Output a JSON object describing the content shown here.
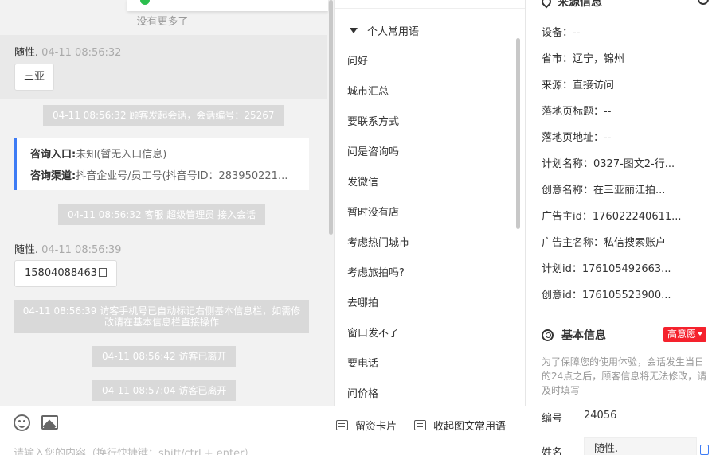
{
  "chat": {
    "no_more": "没有更多了",
    "msg1": {
      "sender": "随性.",
      "time": "04-11 08:56:32",
      "text": "三亚"
    },
    "sys1": "04-11 08:56:32 顾客发起会话，会话编号：25267",
    "consult": {
      "entry_label": "咨询入口:",
      "entry_value": "未知(暂无入口信息)",
      "channel_label": "咨询渠道:",
      "channel_value": "抖音企业号/员工号(抖音号ID：283950221..."
    },
    "sys2": "04-11 08:56:32 客服 超级管理员 接入会话",
    "msg2": {
      "sender": "随性.",
      "time": "04-11 08:56:39",
      "text": "15804088463"
    },
    "sys3": "04-11 08:56:39 访客手机号已自动标记右侧基本信息栏，如需修改请在基本信息栏直接操作",
    "sys4": "04-11 08:56:42 访客已离开",
    "sys5": "04-11 08:57:04 访客已离开"
  },
  "input": {
    "leave_card": "留资卡片",
    "collapse": "收起图文常用语",
    "placeholder": "请输入您的内容（换行快捷键：shift/ctrl + enter）"
  },
  "phrases": {
    "header": "个人常用语",
    "items": [
      "问好",
      "城市汇总",
      "要联系方式",
      "问是咨询吗",
      "发微信",
      "暂时没有店",
      "考虑热门城市",
      "考虑旅拍吗?",
      "去哪拍",
      "窗口发不了",
      "要电话",
      "问价格"
    ]
  },
  "source": {
    "title": "来源信息",
    "rows": [
      {
        "label": "设备：",
        "value": "--"
      },
      {
        "label": "省市：",
        "value": "辽宁，锦州"
      },
      {
        "label": "来源：",
        "value": "直接访问"
      },
      {
        "label": "落地页标题：",
        "value": "--"
      },
      {
        "label": "落地页地址：",
        "value": "--"
      },
      {
        "label": "计划名称：",
        "value": "0327-图文2-行..."
      },
      {
        "label": "创意名称：",
        "value": "在三亚丽江拍..."
      },
      {
        "label": "广告主id：",
        "value": "176022240611..."
      },
      {
        "label": "广告主名称：",
        "value": "私信搜索账户"
      },
      {
        "label": "计划id：",
        "value": "176105492663..."
      },
      {
        "label": "创意id：",
        "value": "176105523900..."
      }
    ]
  },
  "basic": {
    "title": "基本信息",
    "intent_badge": "高意愿",
    "tip": "为了保障您的使用体验，会话发生当日的24点之后，顾客信息将无法修改，请及时填写",
    "number_label": "编号",
    "number_value": "24056",
    "name_label": "姓名",
    "name_value": "随性."
  },
  "colors": {
    "accent": "#3e7cf5",
    "badge": "#f5222d",
    "online": "#2cbe4e"
  }
}
